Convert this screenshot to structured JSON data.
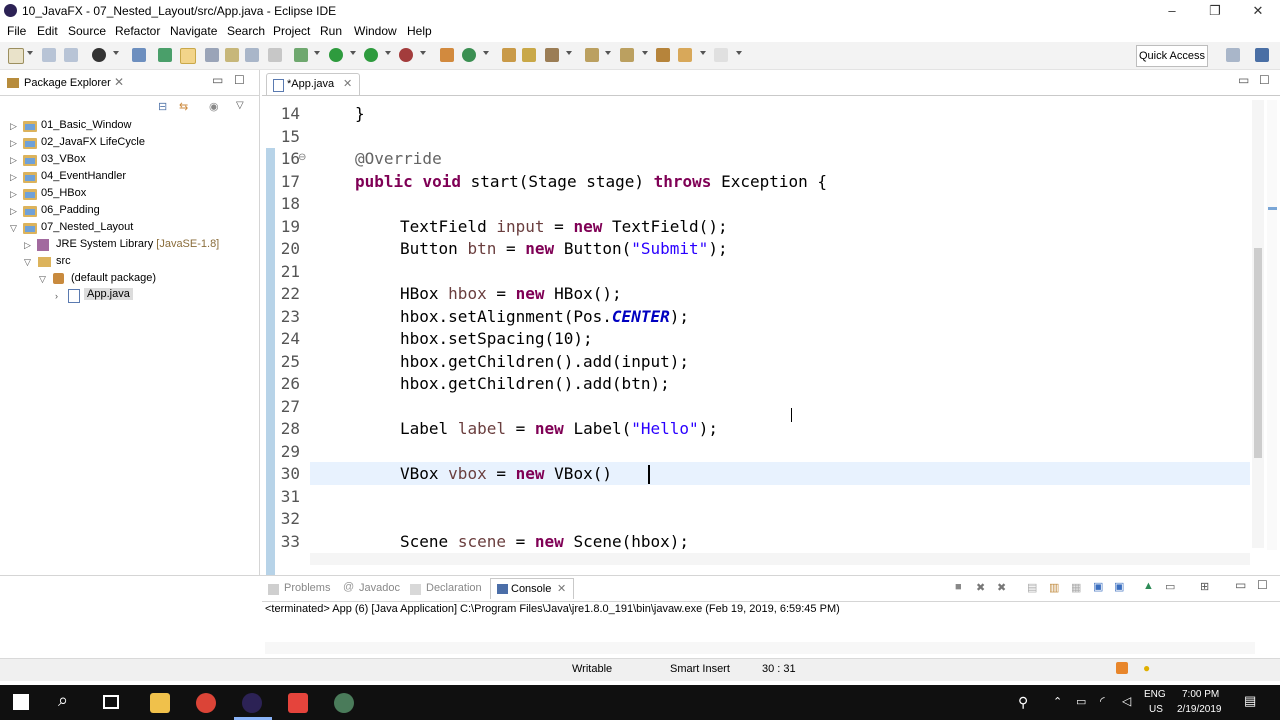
{
  "window": {
    "title": "10_JavaFX - 07_Nested_Layout/src/App.java - Eclipse IDE",
    "minimize": "–",
    "restore": "❐",
    "close": "✕"
  },
  "menu": [
    "File",
    "Edit",
    "Source",
    "Refactor",
    "Navigate",
    "Search",
    "Project",
    "Run",
    "Window",
    "Help"
  ],
  "toolbar": {
    "quick_access": "Quick Access"
  },
  "package_explorer": {
    "title": "Package Explorer",
    "items": [
      {
        "label": "01_Basic_Window"
      },
      {
        "label": "02_JavaFX LifeCycle"
      },
      {
        "label": "03_VBox"
      },
      {
        "label": "04_EventHandler"
      },
      {
        "label": "05_HBox"
      },
      {
        "label": "06_Padding"
      },
      {
        "label": "07_Nested_Layout"
      },
      {
        "label": "JRE System Library",
        "suffix": "[JavaSE-1.8]"
      },
      {
        "label": "src"
      },
      {
        "label": "(default package)"
      },
      {
        "label": "App.java"
      }
    ]
  },
  "editor": {
    "tab_label": "*App.java",
    "line_numbers": [
      "14",
      "15",
      "16",
      "17",
      "18",
      "19",
      "20",
      "21",
      "22",
      "23",
      "24",
      "25",
      "26",
      "27",
      "28",
      "29",
      "30",
      "31",
      "32",
      "33"
    ],
    "fold_marker": "⊖"
  },
  "code": {
    "l14": "}",
    "l16": "@Override",
    "l17": [
      "public",
      "void",
      "start(Stage stage)",
      "throws",
      "Exception {"
    ],
    "l19": [
      "TextField",
      "input",
      "=",
      "new",
      "TextField();"
    ],
    "l20": [
      "Button",
      "btn",
      "=",
      "new",
      "Button(",
      "\"Submit\"",
      ");"
    ],
    "l22": [
      "HBox",
      "hbox",
      "=",
      "new",
      "HBox();"
    ],
    "l23": [
      "hbox.setAlignment(Pos.",
      "CENTER",
      ");"
    ],
    "l24": "hbox.setSpacing(10);",
    "l25": "hbox.getChildren().add(input);",
    "l26": "hbox.getChildren().add(btn);",
    "l28": [
      "Label",
      "label",
      "=",
      "new",
      "Label(",
      "\"Hello\"",
      ");"
    ],
    "l30": [
      "VBox",
      "vbox",
      "=",
      "new",
      "VBox()"
    ],
    "l33": [
      "Scene",
      "scene",
      "=",
      "new",
      "Scene(hbox);"
    ]
  },
  "bottom": {
    "tabs": [
      "Problems",
      "Javadoc",
      "Declaration",
      "Console"
    ],
    "console_text": "<terminated> App (6) [Java Application] C:\\Program Files\\Java\\jre1.8.0_191\\bin\\javaw.exe (Feb 19, 2019, 6:59:45 PM)"
  },
  "status": {
    "writable": "Writable",
    "insert_mode": "Smart Insert",
    "position": "30 : 31"
  },
  "taskbar": {
    "lang": "ENG",
    "region": "US",
    "time": "7:00 PM",
    "date": "2/19/2019"
  }
}
